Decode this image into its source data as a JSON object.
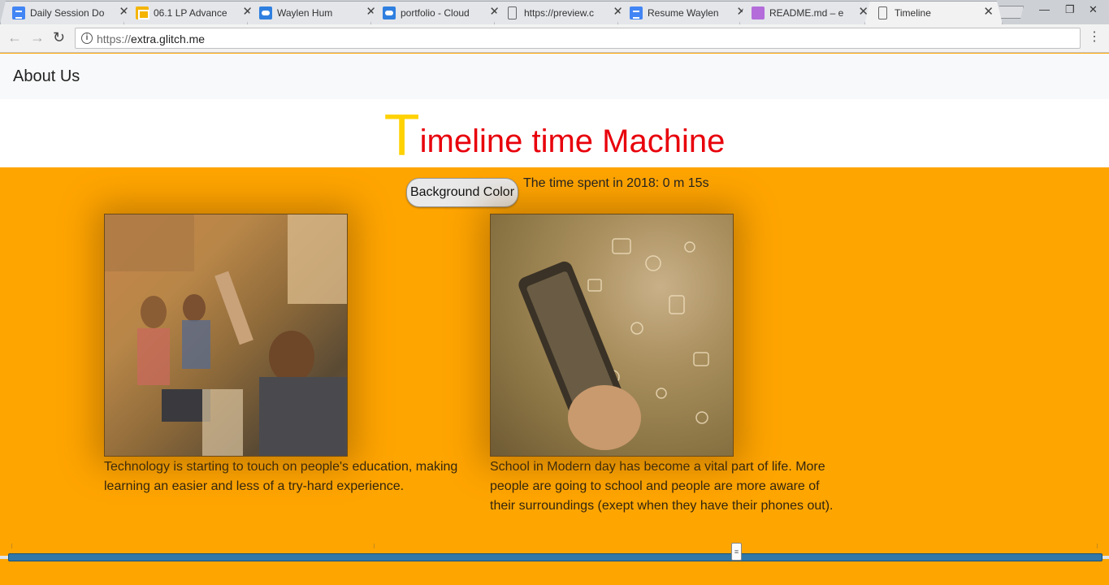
{
  "browser": {
    "tabs": [
      {
        "title": "Daily Session Do",
        "favicon": "doc-icon",
        "active": false
      },
      {
        "title": "06.1 LP Advance",
        "favicon": "slides-icon",
        "active": false
      },
      {
        "title": "Waylen Hum",
        "favicon": "cloud-icon",
        "active": false
      },
      {
        "title": "portfolio - Cloud",
        "favicon": "cloud-icon",
        "active": false
      },
      {
        "title": "https://preview.c",
        "favicon": "page-icon",
        "active": false
      },
      {
        "title": "Resume Waylen",
        "favicon": "doc-icon",
        "active": false
      },
      {
        "title": "README.md – e",
        "favicon": "glitch-icon",
        "active": false
      },
      {
        "title": "Timeline",
        "favicon": "page-icon",
        "active": true
      }
    ],
    "url_scheme": "https://",
    "url_host": "extra.glitch.me"
  },
  "page": {
    "nav_link": "About Us",
    "title_first_letter": "T",
    "title_rest": "imeline time Machine",
    "background_button": "Background Color",
    "timer_text": "The time spent in 2018: 0 m 15s",
    "cards": [
      {
        "image": "classroom-photo",
        "caption": "Technology is starting to touch on people's education, making learning an easier and less of a try-hard experience."
      },
      {
        "image": "smartphone-photo",
        "caption": "School in Modern day has become a vital part of life. More people are going to school and people are more aware of their surroundings (exept when they have their phones out)."
      }
    ],
    "timeline_position": 0.665
  },
  "colors": {
    "page_background": "#ffa500",
    "title_red": "#e8000b",
    "title_yellow": "#ffd200",
    "timeline_blue": "#2f78a9"
  }
}
